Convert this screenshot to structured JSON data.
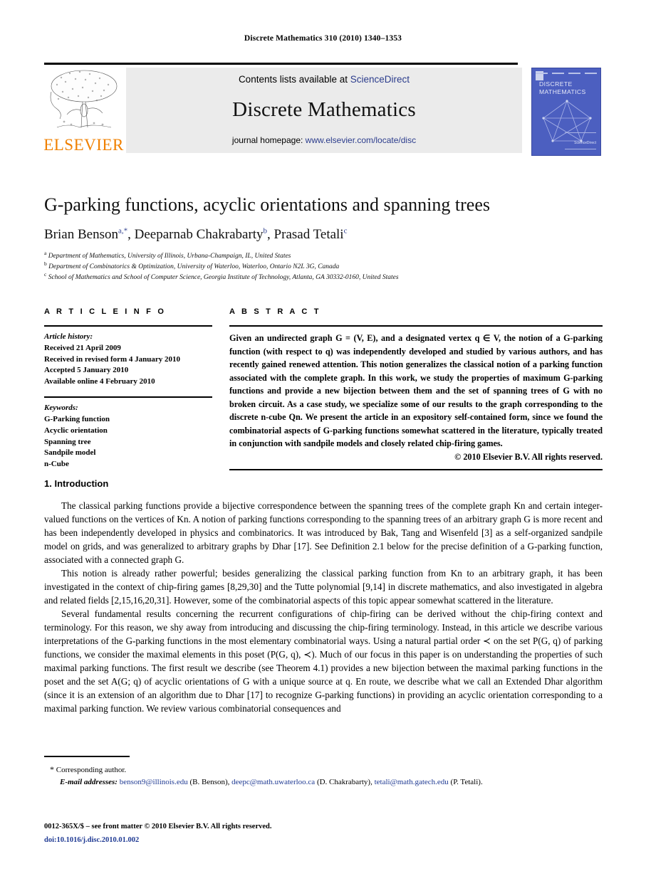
{
  "running_head": "Discrete Mathematics 310 (2010) 1340–1353",
  "masthead": {
    "contents_prefix": "Contents lists available at ",
    "contents_link": "ScienceDirect",
    "journal_name": "Discrete Mathematics",
    "homepage_prefix": "journal homepage: ",
    "homepage_link": "www.elsevier.com/locate/disc",
    "publisher": "ELSEVIER",
    "cover_title_line1": "DISCRETE",
    "cover_title_line2": "MATHEMATICS",
    "cover_badge": "ScienceDirect",
    "link_color": "#2B3C8C",
    "band_color": "#ebebeb",
    "cover_color": "#4c5fc0",
    "elsevier_orange": "#F08000"
  },
  "title": "G-parking functions, acyclic orientations and spanning trees",
  "authors": [
    {
      "name": "Brian Benson",
      "marks": "a,*"
    },
    {
      "name": "Deeparnab Chakrabarty",
      "marks": "b"
    },
    {
      "name": "Prasad Tetali",
      "marks": "c"
    }
  ],
  "authors_separator": ", ",
  "affiliations": [
    {
      "mark": "a",
      "text": "Department of Mathematics, University of Illinois, Urbana-Champaign, IL, United States"
    },
    {
      "mark": "b",
      "text": "Department of Combinatorics & Optimization, University of Waterloo, Waterloo, Ontario N2L 3G, Canada"
    },
    {
      "mark": "c",
      "text": "School of Mathematics and School of Computer Science, Georgia Institute of Technology, Atlanta, GA 30332-0160, United States"
    }
  ],
  "article_info": {
    "label": "A R T I C L E    I N F O",
    "history_heading": "Article history:",
    "history": [
      "Received 21 April 2009",
      "Received in revised form 4 January 2010",
      "Accepted 5 January 2010",
      "Available online 4 February 2010"
    ],
    "keywords_heading": "Keywords:",
    "keywords": [
      "G-Parking function",
      "Acyclic orientation",
      "Spanning tree",
      "Sandpile model",
      "n-Cube"
    ]
  },
  "abstract": {
    "label": "A B S T R A C T",
    "text": "Given an undirected graph G = (V, E), and a designated vertex q ∈ V, the notion of a G-parking function (with respect to q) was independently developed and studied by various authors, and has recently gained renewed attention. This notion generalizes the classical notion of a parking function associated with the complete graph. In this work, we study the properties of maximum G-parking functions and provide a new bijection between them and the set of spanning trees of G with no broken circuit. As a case study, we specialize some of our results to the graph corresponding to the discrete n-cube Qn. We present the article in an expository self-contained form, since we found the combinatorial aspects of G-parking functions somewhat scattered in the literature, typically treated in conjunction with sandpile models and closely related chip-firing games.",
    "copyright": "© 2010 Elsevier B.V. All rights reserved."
  },
  "section": {
    "number": "1.",
    "title": "Introduction"
  },
  "paragraphs": [
    "The classical parking functions provide a bijective correspondence between the spanning trees of the complete graph Kn and certain integer-valued functions on the vertices of Kn. A notion of parking functions corresponding to the spanning trees of an arbitrary graph G is more recent and has been independently developed in physics and combinatorics. It was introduced by Bak, Tang and Wisenfeld [3] as a self-organized sandpile model on grids, and was generalized to arbitrary graphs by Dhar [17]. See Definition 2.1 below for the precise definition of a G-parking function, associated with a connected graph G.",
    "This notion is already rather powerful; besides generalizing the classical parking function from Kn to an arbitrary graph, it has been investigated in the context of chip-firing games [8,29,30] and the Tutte polynomial [9,14] in discrete mathematics, and also investigated in algebra and related fields [2,15,16,20,31]. However, some of the combinatorial aspects of this topic appear somewhat scattered in the literature.",
    "Several fundamental results concerning the recurrent configurations of chip-firing can be derived without the chip-firing context and terminology. For this reason, we shy away from introducing and discussing the chip-firing terminology. Instead, in this article we describe various interpretations of the G-parking functions in the most elementary combinatorial ways. Using a natural partial order ≺ on the set P(G, q) of parking functions, we consider the maximal elements in this poset (P(G, q), ≺). Much of our focus in this paper is on understanding the properties of such maximal parking functions. The first result we describe (see Theorem 4.1) provides a new bijection between the maximal parking functions in the poset and the set A(G; q) of acyclic orientations of G with a unique source at q. En route, we describe what we call an Extended Dhar algorithm (since it is an extension of an algorithm due to Dhar [17] to recognize G-parking functions) in providing an acyclic orientation corresponding to a maximal parking function. We review various combinatorial consequences and"
  ],
  "footnote": {
    "star": "*",
    "corresponding": "Corresponding author.",
    "email_label": "E-mail addresses:",
    "emails": [
      {
        "address": "benson9@illinois.edu",
        "owner": "(B. Benson)"
      },
      {
        "address": "deepc@math.uwaterloo.ca",
        "owner": "(D. Chakrabarty)"
      },
      {
        "address": "tetali@math.gatech.edu",
        "owner": "(P. Tetali)"
      }
    ]
  },
  "imprint": {
    "front_matter": "0012-365X/$ – see front matter © 2010 Elsevier B.V. All rights reserved.",
    "doi": "doi:10.1016/j.disc.2010.01.002"
  }
}
